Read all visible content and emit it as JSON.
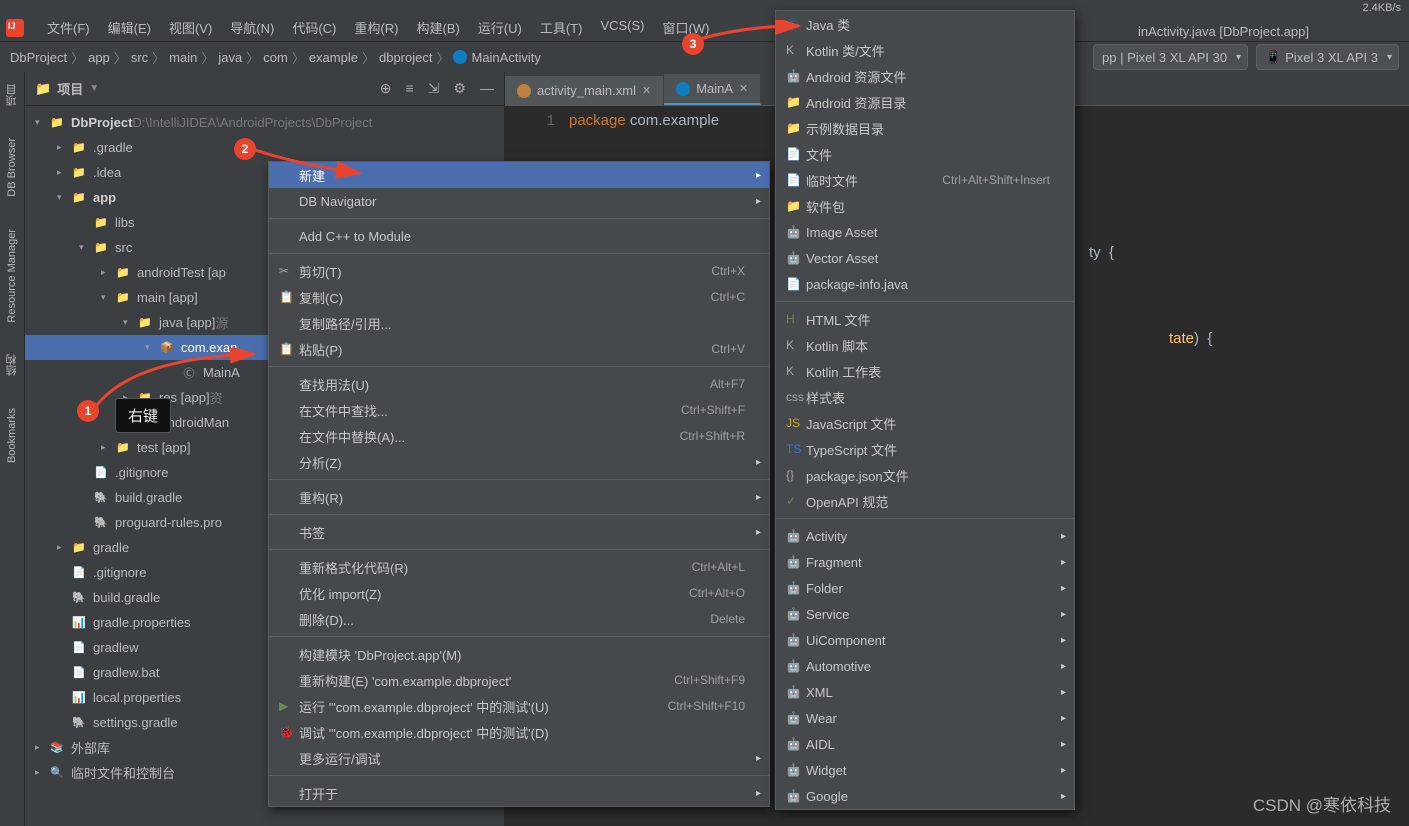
{
  "status": {
    "speed": "2.4KB/s"
  },
  "menubar": {
    "items": [
      "文件(F)",
      "编辑(E)",
      "视图(V)",
      "导航(N)",
      "代码(C)",
      "重构(R)",
      "构建(B)",
      "运行(U)",
      "工具(T)",
      "VCS(S)",
      "窗口(W)"
    ]
  },
  "title_fragment": "inActivity.java [DbProject.app]",
  "breadcrumb": [
    "DbProject",
    "app",
    "src",
    "main",
    "java",
    "com",
    "example",
    "dbproject",
    "MainActivity"
  ],
  "devices": {
    "sel1": "pp | Pixel 3 XL API 30",
    "sel2": "Pixel 3 XL API 3"
  },
  "sidebar": {
    "title": "项目",
    "items": [
      {
        "ind": 0,
        "arr": "▾",
        "ico": "📁",
        "label": "DbProject",
        "extra": "D:\\IntelliJIDEA\\AndroidProjects\\DbProject",
        "bold": true
      },
      {
        "ind": 1,
        "arr": "▸",
        "ico": "📁",
        "label": ".gradle",
        "brown": true
      },
      {
        "ind": 1,
        "arr": "▸",
        "ico": "📁",
        "label": ".idea",
        "brown": true
      },
      {
        "ind": 1,
        "arr": "▾",
        "ico": "📁",
        "label": "app",
        "bold": true
      },
      {
        "ind": 2,
        "arr": "",
        "ico": "📁",
        "label": "libs"
      },
      {
        "ind": 2,
        "arr": "▾",
        "ico": "📁",
        "label": "src"
      },
      {
        "ind": 3,
        "arr": "▸",
        "ico": "📁",
        "label": "androidTest [ap"
      },
      {
        "ind": 3,
        "arr": "▾",
        "ico": "📁",
        "label": "main [app]"
      },
      {
        "ind": 4,
        "arr": "▾",
        "ico": "📁",
        "label": "java [app]",
        "extra": "源"
      },
      {
        "ind": 5,
        "arr": "▾",
        "ico": "📦",
        "label": "com.exan",
        "sel": true
      },
      {
        "ind": 6,
        "arr": "",
        "ico": "Ⓒ",
        "label": "MainA"
      },
      {
        "ind": 4,
        "arr": "▸",
        "ico": "📁",
        "label": "res [app]",
        "extra": "资"
      },
      {
        "ind": 4,
        "arr": "",
        "ico": "📄",
        "label": "AndroidMan"
      },
      {
        "ind": 3,
        "arr": "▸",
        "ico": "📁",
        "label": "test [app]"
      },
      {
        "ind": 2,
        "arr": "",
        "ico": "📄",
        "label": ".gitignore"
      },
      {
        "ind": 2,
        "arr": "",
        "ico": "🐘",
        "label": "build.gradle"
      },
      {
        "ind": 2,
        "arr": "",
        "ico": "🐘",
        "label": "proguard-rules.pro"
      },
      {
        "ind": 1,
        "arr": "▸",
        "ico": "📁",
        "label": "gradle"
      },
      {
        "ind": 1,
        "arr": "",
        "ico": "📄",
        "label": ".gitignore"
      },
      {
        "ind": 1,
        "arr": "",
        "ico": "🐘",
        "label": "build.gradle"
      },
      {
        "ind": 1,
        "arr": "",
        "ico": "📊",
        "label": "gradle.properties"
      },
      {
        "ind": 1,
        "arr": "",
        "ico": "📄",
        "label": "gradlew"
      },
      {
        "ind": 1,
        "arr": "",
        "ico": "📄",
        "label": "gradlew.bat"
      },
      {
        "ind": 1,
        "arr": "",
        "ico": "📊",
        "label": "local.properties"
      },
      {
        "ind": 1,
        "arr": "",
        "ico": "🐘",
        "label": "settings.gradle"
      },
      {
        "ind": 0,
        "arr": "▸",
        "ico": "📚",
        "label": "外部库"
      },
      {
        "ind": 0,
        "arr": "▸",
        "ico": "🔍",
        "label": "临时文件和控制台"
      }
    ]
  },
  "lefttabs": [
    "项目",
    "DB Browser",
    "Resource Manager",
    "结构",
    "Bookmarks"
  ],
  "tabs": [
    {
      "label": "activity_main.xml",
      "active": false
    },
    {
      "label": "MainA",
      "active": true
    }
  ],
  "code": {
    "line1": "1",
    "text1_kw": "package ",
    "text1_id": "com.example",
    "frag_ty": "ty  ",
    "frag_brace": "{",
    "frag_tate": "tate",
    "frag_paren": ")  {"
  },
  "context_menu": [
    {
      "label": "新建",
      "sub": true,
      "hl": true
    },
    {
      "label": "DB Navigator",
      "sub": true
    },
    {
      "sep": true
    },
    {
      "label": "Add C++ to Module"
    },
    {
      "sep": true
    },
    {
      "ico": "✂",
      "label": "剪切(T)",
      "sc": "Ctrl+X"
    },
    {
      "ico": "📋",
      "label": "复制(C)",
      "sc": "Ctrl+C"
    },
    {
      "label": "复制路径/引用..."
    },
    {
      "ico": "📋",
      "label": "粘贴(P)",
      "sc": "Ctrl+V"
    },
    {
      "sep": true
    },
    {
      "label": "查找用法(U)",
      "sc": "Alt+F7"
    },
    {
      "label": "在文件中查找...",
      "sc": "Ctrl+Shift+F"
    },
    {
      "label": "在文件中替换(A)...",
      "sc": "Ctrl+Shift+R"
    },
    {
      "label": "分析(Z)",
      "sub": true
    },
    {
      "sep": true
    },
    {
      "label": "重构(R)",
      "sub": true
    },
    {
      "sep": true
    },
    {
      "label": "书签",
      "sub": true
    },
    {
      "sep": true
    },
    {
      "label": "重新格式化代码(R)",
      "sc": "Ctrl+Alt+L"
    },
    {
      "label": "优化 import(Z)",
      "sc": "Ctrl+Alt+O"
    },
    {
      "label": "删除(D)...",
      "sc": "Delete"
    },
    {
      "sep": true
    },
    {
      "label": "构建模块 'DbProject.app'(M)"
    },
    {
      "label": "重新构建(E) 'com.example.dbproject'",
      "sc": "Ctrl+Shift+F9"
    },
    {
      "ico": "▶",
      "label": "运行 '\"com.example.dbproject' 中的测试'(U)",
      "sc": "Ctrl+Shift+F10",
      "green": true
    },
    {
      "ico": "🐞",
      "label": "调试 '\"com.example.dbproject' 中的测试'(D)"
    },
    {
      "label": "更多运行/调试",
      "sub": true
    },
    {
      "sep": true
    },
    {
      "label": "打开于",
      "sub": true
    }
  ],
  "new_menu": [
    {
      "ico": "Ⓒ",
      "label": "Java 类",
      "color": "#0d7fc2"
    },
    {
      "ico": "K",
      "label": "Kotlin 类/文件"
    },
    {
      "ico": "🤖",
      "label": "Android 资源文件"
    },
    {
      "ico": "📁",
      "label": "Android 资源目录"
    },
    {
      "ico": "📁",
      "label": "示例数据目录"
    },
    {
      "ico": "📄",
      "label": "文件"
    },
    {
      "ico": "📄",
      "label": "临时文件",
      "sc": "Ctrl+Alt+Shift+Insert"
    },
    {
      "ico": "📁",
      "label": "软件包"
    },
    {
      "ico": "🤖",
      "label": "Image Asset"
    },
    {
      "ico": "🤖",
      "label": "Vector Asset"
    },
    {
      "ico": "📄",
      "label": "package-info.java"
    },
    {
      "sep": true
    },
    {
      "ico": "H",
      "label": "HTML 文件",
      "color": "#6a8759"
    },
    {
      "ico": "K",
      "label": "Kotlin 脚本"
    },
    {
      "ico": "K",
      "label": "Kotlin 工作表"
    },
    {
      "ico": "css",
      "label": "样式表"
    },
    {
      "ico": "JS",
      "label": "JavaScript 文件",
      "color": "#c9a82e"
    },
    {
      "ico": "TS",
      "label": "TypeScript 文件",
      "color": "#3178c6"
    },
    {
      "ico": "{}",
      "label": "package.json文件"
    },
    {
      "ico": "✓",
      "label": "OpenAPI 规范",
      "color": "#6a8759"
    },
    {
      "sep": true
    },
    {
      "ico": "🤖",
      "label": "Activity",
      "sub": true
    },
    {
      "ico": "🤖",
      "label": "Fragment",
      "sub": true
    },
    {
      "ico": "🤖",
      "label": "Folder",
      "sub": true
    },
    {
      "ico": "🤖",
      "label": "Service",
      "sub": true
    },
    {
      "ico": "🤖",
      "label": "UiComponent",
      "sub": true
    },
    {
      "ico": "🤖",
      "label": "Automotive",
      "sub": true
    },
    {
      "ico": "🤖",
      "label": "XML",
      "sub": true
    },
    {
      "ico": "🤖",
      "label": "Wear",
      "sub": true
    },
    {
      "ico": "🤖",
      "label": "AIDL",
      "sub": true
    },
    {
      "ico": "🤖",
      "label": "Widget",
      "sub": true
    },
    {
      "ico": "🤖",
      "label": "Google",
      "sub": true
    }
  ],
  "annotations": {
    "tooltip": "右键",
    "watermark": "CSDN @寒依科技"
  }
}
